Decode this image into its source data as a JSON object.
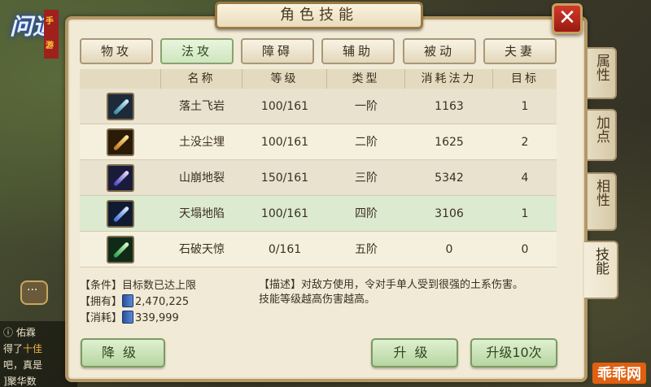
{
  "title": "角色技能",
  "close_label": "✕",
  "logo_text": "问道",
  "logo_tag": "手游",
  "categories": [
    {
      "label": "物攻",
      "active": false
    },
    {
      "label": "法攻",
      "active": true
    },
    {
      "label": "障碍",
      "active": false
    },
    {
      "label": "辅助",
      "active": false
    },
    {
      "label": "被动",
      "active": false
    },
    {
      "label": "夫妻",
      "active": false
    }
  ],
  "table": {
    "headers": [
      "名称",
      "等级",
      "类型",
      "消耗法力",
      "目标"
    ],
    "rows": [
      {
        "icon": "earth-spike-skill-icon",
        "name": "落土飞岩",
        "level": "100/161",
        "type": "一阶",
        "cost": "1163",
        "target": "1"
      },
      {
        "icon": "earth-burst-skill-icon",
        "name": "土没尘埋",
        "level": "100/161",
        "type": "二阶",
        "cost": "1625",
        "target": "2"
      },
      {
        "icon": "earth-quake-skill-icon",
        "name": "山崩地裂",
        "level": "150/161",
        "type": "三阶",
        "cost": "5342",
        "target": "4"
      },
      {
        "icon": "earth-collapse-skill-icon",
        "name": "天塌地陷",
        "level": "100/161",
        "type": "四阶",
        "cost": "3106",
        "target": "1"
      },
      {
        "icon": "earth-shatter-skill-icon",
        "name": "石破天惊",
        "level": "0/161",
        "type": "五阶",
        "cost": "0",
        "target": "0"
      }
    ]
  },
  "info": {
    "condition_label": "【条件】",
    "condition_value": "目标数已达上限",
    "owned_label": "【拥有】",
    "owned_value": "2,470,225",
    "cost_label": "【消耗】",
    "cost_value": "339,999",
    "desc_label": "【描述】",
    "desc_text": "对敌方使用，令对手单人受到很强的土系伤害。",
    "desc_text2": "技能等级越高伤害越高。"
  },
  "buttons": {
    "downgrade": "降级",
    "upgrade": "升级",
    "upgrade10": "升级10次"
  },
  "side_tabs": [
    {
      "label": "属性",
      "active": false
    },
    {
      "label": "加点",
      "active": false
    },
    {
      "label": "相性",
      "active": false
    },
    {
      "label": "技能",
      "active": true
    }
  ],
  "chat": {
    "line1_prefix": "得了",
    "line1_hl": "十佳",
    "line2": "吧，真是",
    "line3": "]聚华数",
    "name": "佑霖"
  },
  "watermark": "乖乖网",
  "colors": {
    "panel_bg": "#f1ead6",
    "active_tab": "#cfe6bf",
    "close_red": "#d23a2a",
    "border_gold": "#b39866"
  }
}
